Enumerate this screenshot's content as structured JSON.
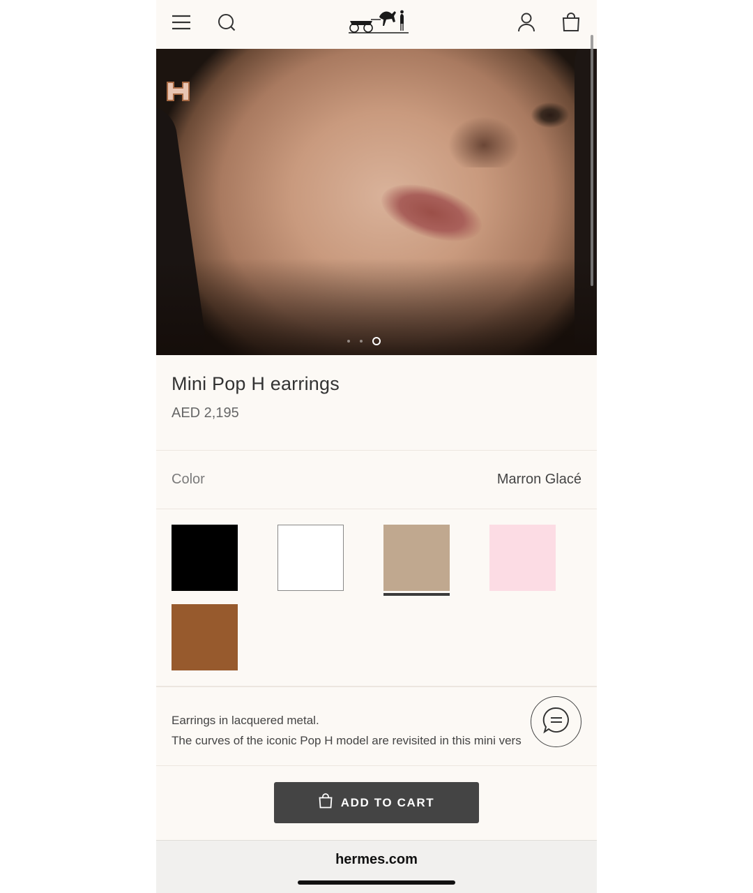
{
  "header": {
    "menu_icon": "hamburger-menu-icon",
    "search_icon": "search-icon",
    "logo": "hermes-carriage-logo",
    "account_icon": "user-account-icon",
    "bag_icon": "shopping-bag-icon"
  },
  "gallery": {
    "total_slides": 3,
    "active_slide": 3
  },
  "product": {
    "title": "Mini Pop H earrings",
    "price": "AED 2,195"
  },
  "color": {
    "label": "Color",
    "selected": "Marron Glacé",
    "swatches": [
      {
        "hex": "#000000",
        "selected": false
      },
      {
        "hex": "#ffffff",
        "selected": false
      },
      {
        "hex": "#c0a88f",
        "selected": true
      },
      {
        "hex": "#fcdce4",
        "selected": false
      },
      {
        "hex": "#975a2d",
        "selected": false
      }
    ]
  },
  "description": {
    "line1": "Earrings in lacquered metal.",
    "line2": "The curves of the iconic Pop H model are revisited in this mini vers"
  },
  "chat": {
    "icon": "chat-bubble-icon"
  },
  "cart": {
    "label": "ADD TO CART",
    "icon": "shopping-bag-icon"
  },
  "browser": {
    "url": "hermes.com"
  },
  "colors": {
    "background": "#fcf9f5",
    "button": "#444444"
  }
}
